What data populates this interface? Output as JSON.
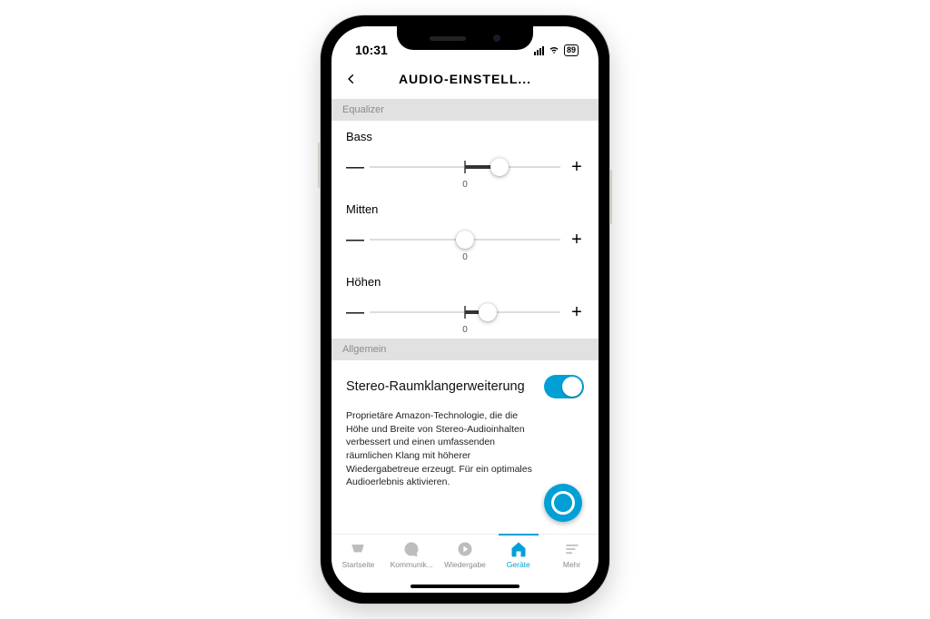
{
  "status": {
    "time": "10:31",
    "battery": "89"
  },
  "header": {
    "title": "AUDIO-EINSTELL..."
  },
  "sections": {
    "equalizer": "Equalizer",
    "general": "Allgemein"
  },
  "eq": {
    "bass": {
      "label": "Bass",
      "tick": "0",
      "valuePercent": 68
    },
    "mitten": {
      "label": "Mitten",
      "tick": "0",
      "valuePercent": 50
    },
    "hoehen": {
      "label": "Höhen",
      "tick": "0",
      "valuePercent": 62
    }
  },
  "symbols": {
    "minus": "—",
    "plus": "+"
  },
  "toggle": {
    "label": "Stereo-Raumklangerweiterung",
    "on": true,
    "description": "Proprietäre Amazon-Technologie, die die Höhe und Breite von Stereo-Audioinhalten verbessert und einen umfassenden räumlichen Klang mit höherer Wiedergabetreue erzeugt. Für ein optimales Audioerlebnis aktivieren."
  },
  "tabs": {
    "home": "Startseite",
    "comm": "Kommunik...",
    "play": "Wiedergabe",
    "devices": "Geräte",
    "more": "Mehr"
  },
  "colors": {
    "accent": "#00a0d6"
  }
}
